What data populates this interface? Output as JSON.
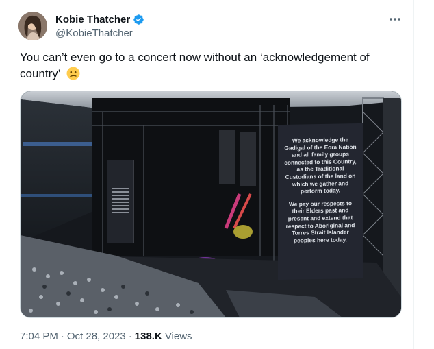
{
  "author": {
    "name": "Kobie Thatcher",
    "handle": "@KobieThatcher"
  },
  "tweet": {
    "text": "You can’t even go to a concert now without an ‘acknowledgement of country’"
  },
  "screen_text": {
    "paragraph1": "We acknowledge the Gadigal of the Eora Nation and all family groups connected to this Country, as the Traditional Custodians of the land on which we gather and perform today.",
    "paragraph2": "We pay our respects to their Elders past and present and extend that respect to Aboriginal and Torres Strait Islander peoples here today."
  },
  "meta": {
    "time": "7:04 PM",
    "separator": "·",
    "date": "Oct 28, 2023",
    "separator2": "·",
    "views_count": "138.K",
    "views_label": "Views"
  },
  "colors": {
    "verified_blue": "#1d9bf0",
    "secondary_text": "#536471",
    "primary_text": "#0f1419"
  },
  "icons": {
    "verified": "verified-badge-icon",
    "more": "more-horizontal-icon",
    "emoji": "confused-face-emoji"
  }
}
